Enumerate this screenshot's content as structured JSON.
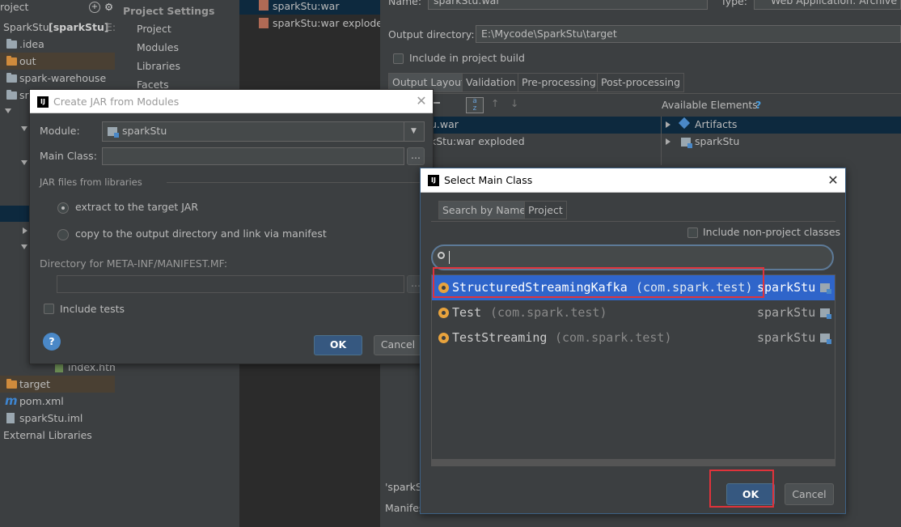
{
  "tree": {
    "header": "roject",
    "root_label": "SparkStu",
    "root_module": "[sparkStu]",
    "root_suffix": "E:",
    "items": [
      {
        "label": ".idea"
      },
      {
        "label": "out"
      },
      {
        "label": "spark-warehouse"
      },
      {
        "label": "src"
      },
      {
        "label": "index.html"
      },
      {
        "label": "target"
      },
      {
        "label": "pom.xml"
      },
      {
        "label": "sparkStu.iml"
      },
      {
        "label": "External Libraries"
      }
    ]
  },
  "settings": {
    "heading": "Project Settings",
    "items": [
      "Project",
      "Modules",
      "Libraries",
      "Facets"
    ]
  },
  "artifacts": {
    "items": [
      "sparkStu:war",
      "sparkStu:war exploded"
    ]
  },
  "right_pane": {
    "name_label": "Name:",
    "name_value": "sparkStu:war",
    "type_label": "Type:",
    "type_value": "Web Application: Archive",
    "output_dir_label": "Output directory:",
    "output_dir_value": "E:\\Mycode\\SparkStu\\target",
    "include_build_label": "Include in project build",
    "tabs": [
      "Output Layout",
      "Validation",
      "Pre-processing",
      "Post-processing"
    ],
    "available_label": "Available Elements",
    "help_mark": "?",
    "layout_items": [
      "u.war",
      "kStu:war exploded"
    ],
    "available_items": [
      "Artifacts",
      "sparkStu"
    ],
    "bottom_lines": [
      "'sparkS",
      "Manifes"
    ]
  },
  "jar_dialog": {
    "title": "Create JAR from Modules",
    "module_label": "Module:",
    "module_value": "sparkStu",
    "main_class_label": "Main Class:",
    "main_class_value": "",
    "browse_label": "...",
    "jar_files_label": "JAR files from libraries",
    "option_extract": "extract to the target JAR",
    "option_copy": "copy to the output directory and link via manifest",
    "manifest_dir_label": "Directory for META-INF/MANIFEST.MF:",
    "manifest_dir_value": "",
    "include_tests_label": "Include tests",
    "ok_label": "OK",
    "cancel_label": "Cancel",
    "help_mark": "?"
  },
  "main_class_dialog": {
    "title": "Select Main Class",
    "tabs": [
      "Search by Name",
      "Project"
    ],
    "include_nonproject_label": "Include non-project classes",
    "search_value": "",
    "classes": [
      {
        "name": "StructuredStreamingKafka",
        "package": "(com.spark.test)",
        "module": "sparkStu"
      },
      {
        "name": "Test",
        "package": "(com.spark.test)",
        "module": "sparkStu"
      },
      {
        "name": "TestStreaming",
        "package": "(com.spark.test)",
        "module": "sparkStu"
      }
    ],
    "ok_label": "OK",
    "cancel_label": "Cancel"
  },
  "colors": {
    "background": "#3c3f41",
    "selection": "#2f65ca",
    "highlight_box": "#e0333b",
    "default_button": "#365880"
  }
}
